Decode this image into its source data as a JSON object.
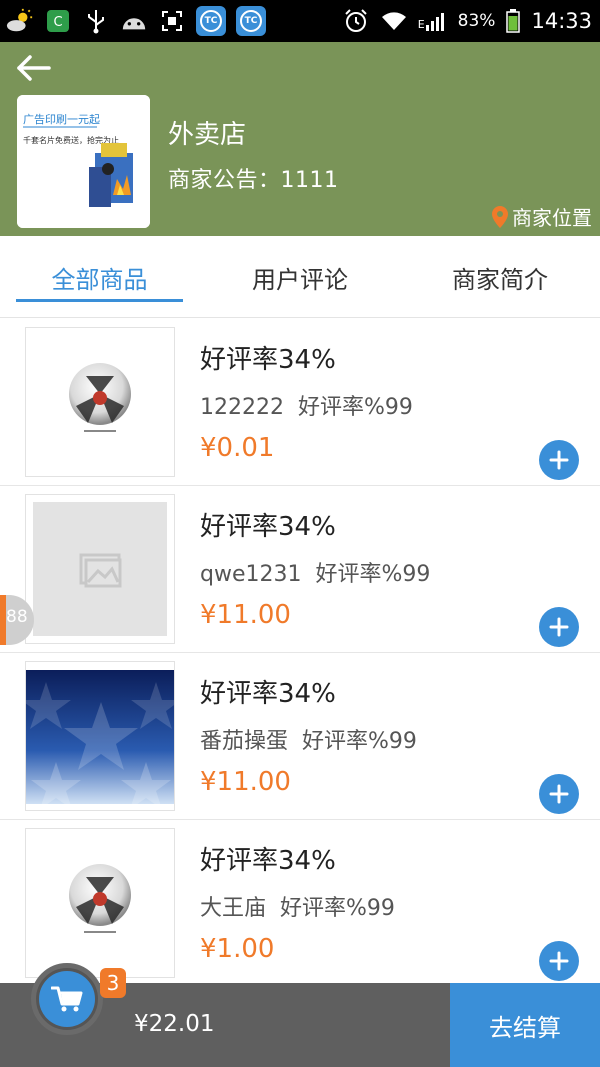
{
  "status_bar": {
    "tc_label": "TC",
    "battery": "83%",
    "network": "E",
    "time": "14:33"
  },
  "header": {
    "shop_name": "外卖店",
    "notice": "商家公告：1111",
    "location_label": "商家位置",
    "logo": {
      "headline": "广告印刷一元起",
      "line2": "千套名片免费送，抢完为止"
    },
    "background_color": "#7a9458"
  },
  "tabs": [
    {
      "label": "全部商品",
      "active": true
    },
    {
      "label": "用户评论",
      "active": false
    },
    {
      "label": "商家简介",
      "active": false
    }
  ],
  "products": [
    {
      "title": "好评率34%",
      "name": "122222",
      "rating": "好评率%99",
      "price": "¥0.01",
      "image": "soccer-ball"
    },
    {
      "title": "好评率34%",
      "name": "qwe1231",
      "rating": "好评率%99",
      "price": "¥11.00",
      "image": "placeholder"
    },
    {
      "title": "好评率34%",
      "name": "番茄操蛋",
      "rating": "好评率%99",
      "price": "¥11.00",
      "image": "blue-star-pattern"
    },
    {
      "title": "好评率34%",
      "name": "大王庙",
      "rating": "好评率%99",
      "price": "¥1.00",
      "image": "soccer-ball"
    }
  ],
  "side_badge": "88",
  "cart": {
    "count": "3",
    "total": "¥22.01",
    "checkout_label": "去结算"
  },
  "colors": {
    "accent": "#3a8fd8",
    "price": "#f07a2a",
    "header": "#7a9458",
    "bottom_bar": "#5f5f5f"
  }
}
